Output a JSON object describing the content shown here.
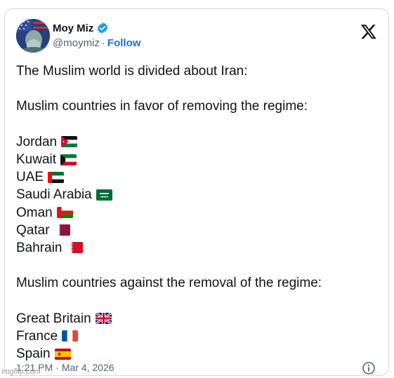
{
  "tweet": {
    "author": {
      "display_name": "Moy Miz",
      "handle": "@moymiz",
      "separator": "·",
      "follow_label": "Follow"
    },
    "lines": [
      {
        "text": "The Muslim world is divided about Iran:"
      },
      {
        "blank": true
      },
      {
        "text": "Muslim countries in favor of removing the regime:"
      },
      {
        "blank": true
      },
      {
        "text": "Jordan",
        "flag": "jordan-flag"
      },
      {
        "text": "Kuwait",
        "flag": "kuwait-flag"
      },
      {
        "text": "UAE",
        "flag": "uae-flag"
      },
      {
        "text": "Saudi Arabia",
        "flag": "saudi-arabia-flag"
      },
      {
        "text": "Oman",
        "flag": "oman-flag"
      },
      {
        "text": "Qatar",
        "flag": "qatar-flag"
      },
      {
        "text": "Bahrain",
        "flag": "bahrain-flag"
      },
      {
        "blank": true
      },
      {
        "text": "Muslim countries against the removal of the regime:"
      },
      {
        "blank": true
      },
      {
        "text": "Great Britain",
        "flag": "great-britain-flag"
      },
      {
        "text": "France",
        "flag": "france-flag"
      },
      {
        "text": "Spain",
        "flag": "spain-flag"
      }
    ],
    "time": "1:21 PM",
    "date_separator": "·",
    "date": "Mar 4, 2026"
  },
  "watermark": "imgflip.com",
  "colors": {
    "link": "#1d6fd6",
    "verified": "#1d9bf0",
    "muted": "#536471",
    "border": "#cfd9de"
  }
}
